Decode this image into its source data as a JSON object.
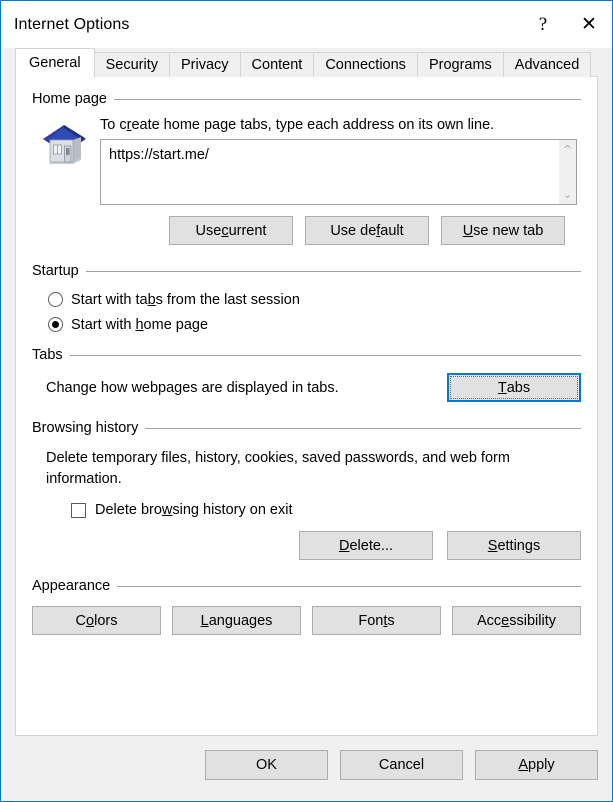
{
  "window": {
    "title": "Internet Options",
    "help_button": "?",
    "close_button": "✕",
    "accent_color": "#0078d7",
    "face_color": "#f0f0f0"
  },
  "tabs": [
    {
      "label": "General",
      "active": true
    },
    {
      "label": "Security",
      "active": false
    },
    {
      "label": "Privacy",
      "active": false
    },
    {
      "label": "Content",
      "active": false
    },
    {
      "label": "Connections",
      "active": false
    },
    {
      "label": "Programs",
      "active": false
    },
    {
      "label": "Advanced",
      "active": false
    }
  ],
  "home_page": {
    "group_title": "Home page",
    "icon": "house-icon",
    "description": "To create home page tabs, type each address on its own line.",
    "description_accel": "c",
    "url_value": "https://start.me/",
    "scroll_up": "⌃",
    "scroll_down": "⌄",
    "buttons": [
      {
        "label": "Use current",
        "accel": "c"
      },
      {
        "label": "Use default",
        "accel": "f"
      },
      {
        "label": "Use new tab",
        "accel": "U"
      }
    ]
  },
  "startup": {
    "group_title": "Startup",
    "options": [
      {
        "label": "Start with tabs from the last session",
        "accel": "b",
        "checked": false
      },
      {
        "label": "Start with home page",
        "accel": "h",
        "checked": true
      }
    ]
  },
  "tabs_section": {
    "group_title": "Tabs",
    "description": "Change how webpages are displayed in tabs.",
    "button_label": "Tabs",
    "button_accel": "T",
    "button_focused": true
  },
  "browsing_history": {
    "group_title": "Browsing history",
    "description": "Delete temporary files, history, cookies, saved passwords, and web form information.",
    "checkbox_label": "Delete browsing history on exit",
    "checkbox_accel": "w",
    "checkbox_checked": false,
    "buttons": [
      {
        "label": "Delete...",
        "accel": "D"
      },
      {
        "label": "Settings",
        "accel": "S"
      }
    ]
  },
  "appearance": {
    "group_title": "Appearance",
    "buttons": [
      {
        "label": "Colors",
        "accel": "o"
      },
      {
        "label": "Languages",
        "accel": "L"
      },
      {
        "label": "Fonts",
        "accel": "t"
      },
      {
        "label": "Accessibility",
        "accel": "e"
      }
    ]
  },
  "footer": {
    "buttons": [
      {
        "label": "OK",
        "accel": ""
      },
      {
        "label": "Cancel",
        "accel": ""
      },
      {
        "label": "Apply",
        "accel": "A"
      }
    ]
  }
}
